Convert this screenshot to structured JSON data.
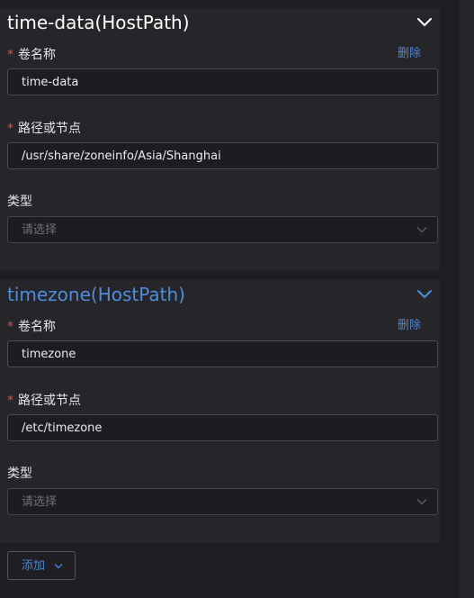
{
  "volumes": [
    {
      "title": "time-data(HostPath)",
      "name_label": "卷名称",
      "delete_label": "删除",
      "name_value": "time-data",
      "path_label": "路径或节点",
      "path_value": "/usr/share/zoneinfo/Asia/Shanghai",
      "type_label": "类型",
      "type_placeholder": "请选择",
      "expanded": true
    },
    {
      "title": "timezone(HostPath)",
      "name_label": "卷名称",
      "delete_label": "删除",
      "name_value": "timezone",
      "path_label": "路径或节点",
      "path_value": "/etc/timezone",
      "type_label": "类型",
      "type_placeholder": "请选择",
      "expanded": true
    }
  ],
  "add_button_label": "添加",
  "required_mark": "*",
  "colors": {
    "accent": "#4a86dc",
    "required": "#e84d4d",
    "panel_bg": "#26262a",
    "input_bg": "#1d1d21"
  },
  "icons": {
    "collapse_1": "chevron-up-icon",
    "collapse_2": "chevron-down-icon",
    "select_caret": "chevron-down-icon",
    "add_caret": "chevron-down-icon"
  }
}
